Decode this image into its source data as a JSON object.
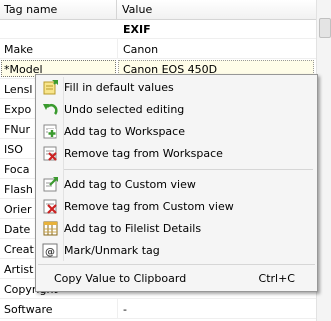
{
  "grid": {
    "header": {
      "col1": "Tag name",
      "col2": "Value"
    },
    "rows": [
      {
        "key": "",
        "value": "EXIF"
      },
      {
        "key": "Make",
        "value": "Canon"
      },
      {
        "key": "*Model",
        "value": "Canon EOS 450D"
      },
      {
        "key": "Lensl",
        "value": ""
      },
      {
        "key": "Expo",
        "value": ""
      },
      {
        "key": "FNur",
        "value": ""
      },
      {
        "key": "ISO",
        "value": ""
      },
      {
        "key": "Foca",
        "value": ""
      },
      {
        "key": "Flash",
        "value": ""
      },
      {
        "key": "Orier",
        "value": ""
      },
      {
        "key": "Date",
        "value": ""
      },
      {
        "key": "Creat",
        "value": ""
      },
      {
        "key": "Artist",
        "value": ""
      },
      {
        "key": "Copyright",
        "value": ""
      },
      {
        "key": "Software",
        "value": "-"
      }
    ]
  },
  "menu": {
    "items": [
      {
        "label": "Fill in default values",
        "icon": "fill-defaults-icon"
      },
      {
        "label": "Undo selected editing",
        "icon": "undo-icon"
      },
      {
        "label": "Add tag to Workspace",
        "icon": "add-workspace-icon"
      },
      {
        "label": "Remove tag from Workspace",
        "icon": "remove-workspace-icon"
      },
      {
        "label": "Add tag to Custom view",
        "icon": "add-custom-view-icon"
      },
      {
        "label": "Remove tag from Custom view",
        "icon": "remove-custom-view-icon"
      },
      {
        "label": "Add tag to Filelist Details",
        "icon": "add-filelist-icon"
      },
      {
        "label": "Mark/Unmark tag",
        "icon": "mark-tag-icon"
      }
    ],
    "copy": {
      "label": "Copy Value to Clipboard",
      "shortcut": "Ctrl+C"
    }
  },
  "colors": {
    "green": "#3a9a2e",
    "red": "#cc2222",
    "selection": "#fffde8"
  }
}
